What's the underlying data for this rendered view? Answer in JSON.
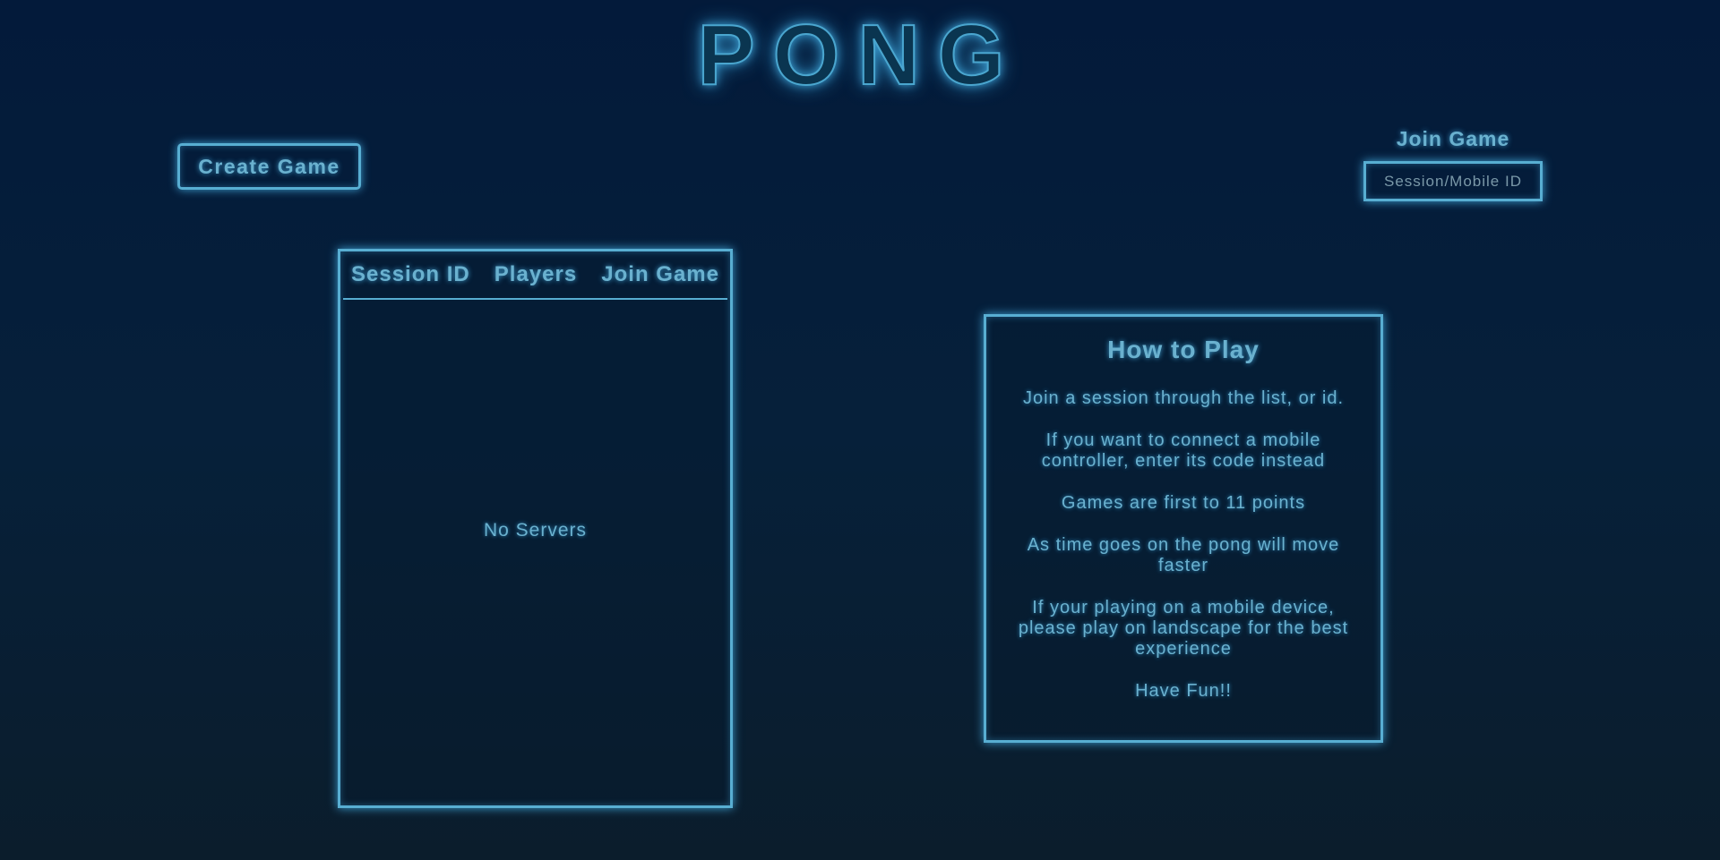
{
  "app": {
    "title": "PONG"
  },
  "actions": {
    "create_game_label": "Create Game",
    "join_game_label": "Join Game",
    "join_input_placeholder": "Session/Mobile ID",
    "join_input_value": ""
  },
  "server_list": {
    "columns": [
      "Session ID",
      "Players",
      "Join Game"
    ],
    "empty_message": "No Servers"
  },
  "how_to_play": {
    "title": "How to Play",
    "instructions": [
      "Join a session through the list, or id.",
      "If you want to connect a mobile controller, enter its code instead",
      "Games are first to 11 points",
      "As time goes on the pong will move faster",
      "If your playing on a mobile device, please play on landscape for the best experience",
      "Have Fun!!"
    ]
  },
  "colors": {
    "background_top": "#031a3a",
    "background_bottom": "#0b1d2c",
    "neon_accent": "#58aed2",
    "text": "#6ab1cf"
  }
}
